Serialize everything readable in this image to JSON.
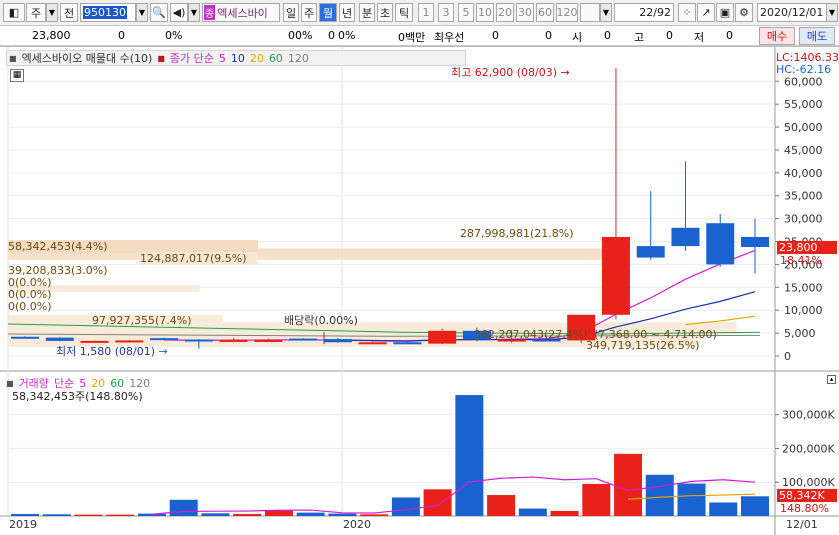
{
  "toolbar": {
    "type_label": "주",
    "prev_label": "전",
    "code": "950130",
    "stock_tag": "종",
    "stock_name": "엑세스바이",
    "periods": [
      "일",
      "주",
      "월",
      "년",
      "분",
      "초",
      "틱"
    ],
    "active_period": "월",
    "intervals": [
      "1",
      "3",
      "5",
      "10",
      "20",
      "30",
      "60",
      "120"
    ],
    "page_counter": "22",
    "page_total": "/92",
    "date": "2020/12/01"
  },
  "quote": {
    "price": "23,800",
    "v1": "0",
    "p1": "0%",
    "v2": "0",
    "p2": "0%",
    "v3": "0",
    "p3": "0%",
    "amount": "0백만",
    "best_label": "최우선",
    "best_v1": "0",
    "best_v2": "0",
    "si_label": "시",
    "si": "0",
    "go_label": "고",
    "go": "0",
    "jeo_label": "저",
    "jeo": "0",
    "buy_label": "매수",
    "sell_label": "매도"
  },
  "price_panel": {
    "legend_title": "엑세스바이오 매물대 수(10)",
    "ma_label": "종가 단순",
    "ma_periods": [
      "5",
      "10",
      "20",
      "60",
      "120"
    ],
    "lc": "LC:1406.33",
    "hc": "HC:-62.16",
    "current_price": "23,800",
    "current_pct": "18.41%",
    "high_note": "최고 62,900 (08/03)",
    "low_note": "최저 1,580 (08/01)",
    "dividend_note": "배당락(0.00%)",
    "volume_profile": [
      "58,342,453(4.4%)",
      "124,887,017(9.5%)",
      "39,208,833(3.0%)",
      "0(0.0%)",
      "0(0.0%)",
      "0(0.0%)",
      "97,927,355(7.4%)",
      "287,998,981(21.8%)",
      "362,207,043(27.4%)",
      "(7,368.00 ~ 4,714.00)",
      "349,719,135(26.5%)"
    ],
    "y_ticks": [
      "60,000",
      "55,000",
      "50,000",
      "45,000",
      "40,000",
      "35,000",
      "30,000",
      "25,000",
      "20,000",
      "15,000",
      "10,000",
      "5,000",
      "0"
    ]
  },
  "volume_panel": {
    "legend_title": "거래량",
    "ma_label": "단순",
    "ma_periods": [
      "5",
      "20",
      "60",
      "120"
    ],
    "current_volume": "58,342,453주(148.80%)",
    "y_ticks": [
      "300,000K",
      "200,000K",
      "100,000K"
    ],
    "current_badge": "58,342K",
    "current_pct": "148.80%"
  },
  "x_axis": {
    "labels": [
      "2019",
      "2020"
    ],
    "cursor_label": "12/01"
  },
  "colors": {
    "up": "#e8221a",
    "down": "#1b62d1",
    "ma5": "#d01dd0",
    "ma10": "#1733a8",
    "ma20": "#e0a800",
    "ma60": "#23a04a",
    "ma120": "#808080",
    "profile": "#f7e7d4"
  },
  "chart_data": {
    "type": "candlestick",
    "period": "monthly",
    "x": [
      "2019-03",
      "2019-04",
      "2019-05",
      "2019-06",
      "2019-07",
      "2019-08",
      "2019-09",
      "2019-10",
      "2019-11",
      "2019-12",
      "2020-01",
      "2020-02",
      "2020-03",
      "2020-04",
      "2020-05",
      "2020-06",
      "2020-07",
      "2020-08",
      "2020-09",
      "2020-10",
      "2020-11",
      "2020-12"
    ],
    "open": [
      4200,
      4000,
      3300,
      3400,
      3900,
      3600,
      3500,
      3500,
      3800,
      3700,
      3000,
      3000,
      2700,
      5500,
      3500,
      3600,
      3400,
      9000,
      24000,
      28000,
      29000,
      26000
    ],
    "high": [
      4300,
      4100,
      3400,
      3500,
      4000,
      3700,
      3900,
      3800,
      3900,
      3900,
      3100,
      3300,
      6000,
      6200,
      5700,
      4300,
      4500,
      62900,
      36000,
      42500,
      31000,
      30000
    ],
    "low": [
      3900,
      3200,
      3200,
      3300,
      3600,
      1580,
      3300,
      3400,
      3600,
      2900,
      2900,
      2600,
      2600,
      3200,
      2900,
      3200,
      2800,
      8000,
      21000,
      23000,
      19500,
      18000
    ],
    "close": [
      4000,
      3300,
      3300,
      3400,
      3600,
      3500,
      3500,
      3500,
      3700,
      3000,
      3000,
      2700,
      5500,
      3600,
      3600,
      3400,
      9000,
      26000,
      21500,
      24000,
      20000,
      23800
    ],
    "volume_k": [
      6000,
      5000,
      4000,
      4000,
      7000,
      48000,
      8000,
      6000,
      16000,
      10000,
      7000,
      5000,
      55000,
      79000,
      358000,
      62000,
      22000,
      15000,
      95000,
      184000,
      122000,
      96000,
      40000,
      58342
    ],
    "ylim": [
      0,
      62900
    ]
  }
}
